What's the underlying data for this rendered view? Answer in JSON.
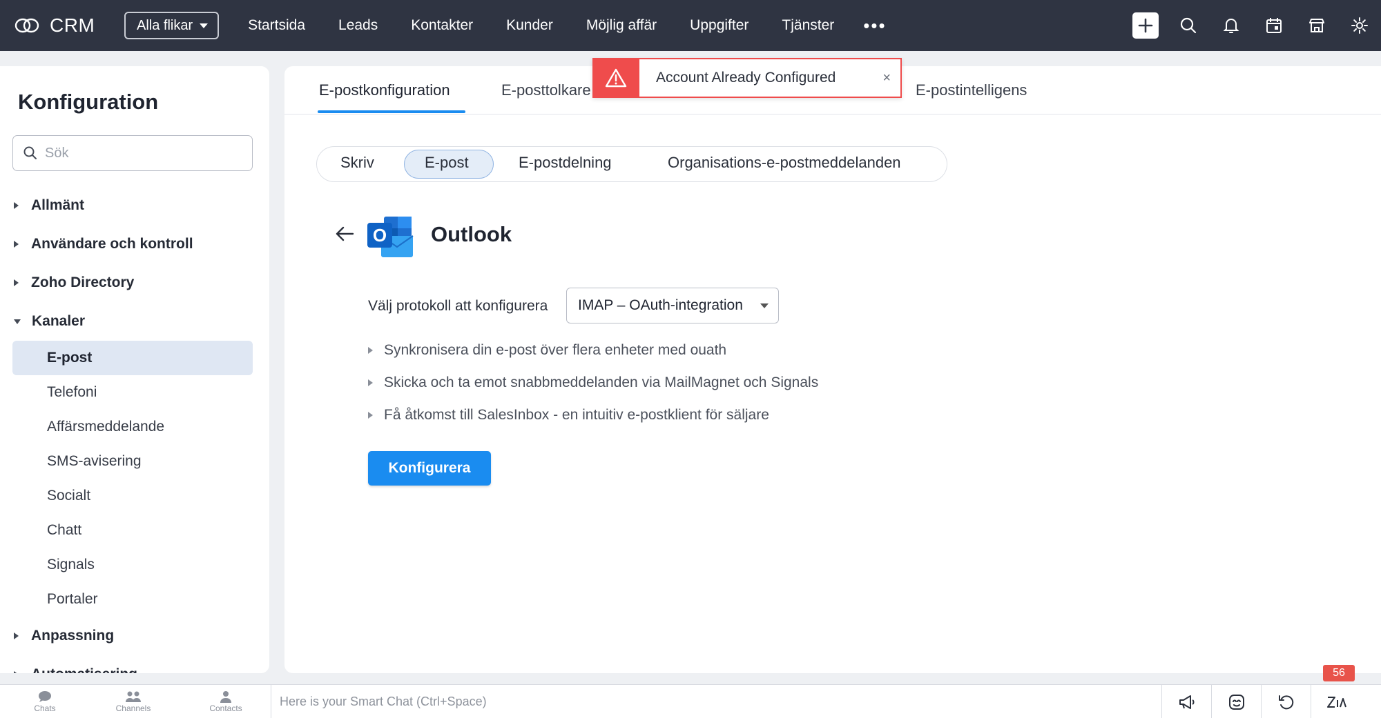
{
  "topbar": {
    "brand": "CRM",
    "all_tabs": "Alla flikar",
    "nav": [
      "Startsida",
      "Leads",
      "Kontakter",
      "Kunder",
      "Möjlig affär",
      "Uppgifter",
      "Tjänster"
    ],
    "more": "•••",
    "icons": [
      "plus-icon",
      "search-icon",
      "bell-icon",
      "calendar-icon",
      "store-icon",
      "gear-icon"
    ]
  },
  "sidebar": {
    "title": "Konfiguration",
    "search_placeholder": "Sök",
    "groups": {
      "allmant": "Allmänt",
      "anvandare": "Användare och kontroll",
      "zoho_directory": "Zoho Directory",
      "kanaler": "Kanaler",
      "anpassning": "Anpassning",
      "automatisering": "Automatisering"
    },
    "channel_items": [
      "E-post",
      "Telefoni",
      "Affärsmeddelande",
      "SMS-avisering",
      "Socialt",
      "Chatt",
      "Signals",
      "Portaler"
    ],
    "active_item": "E-post"
  },
  "main": {
    "tabs": [
      "E-postkonfiguration",
      "E-posttolkare",
      "E-postintelligens"
    ],
    "active_tab": "E-postkonfiguration",
    "pills": [
      "Skriv",
      "E-post",
      "E-postdelning",
      "Organisations-e-postmeddelanden"
    ],
    "active_pill": "E-post",
    "provider": "Outlook",
    "provider_logo_letter": "O",
    "protocol_label": "Välj protokoll att konfigurera",
    "protocol_value": "IMAP – OAuth-integration",
    "features": [
      "Synkronisera din e-post över flera enheter med ouath",
      "Skicka och ta emot snabbmeddelanden via MailMagnet och Signals",
      "Få åtkomst till SalesInbox - en intuitiv e-postklient för säljare"
    ],
    "configure_button": "Konfigurera"
  },
  "toast": {
    "message": "Account Already Configured",
    "close": "×",
    "color": "#ef4c4c"
  },
  "bottombar": {
    "items": [
      "Chats",
      "Channels",
      "Contacts"
    ],
    "smart_chat_placeholder": "Here is your Smart Chat (Ctrl+Space)",
    "badge": "56",
    "right_icons": [
      "megaphone-icon",
      "assistant-icon",
      "refresh-icon",
      "zia-icon"
    ]
  },
  "colors": {
    "topbar": "#2f3442",
    "accent": "#1a8cf0",
    "active_item_bg": "#dfe7f3",
    "error": "#ef4c4c"
  }
}
